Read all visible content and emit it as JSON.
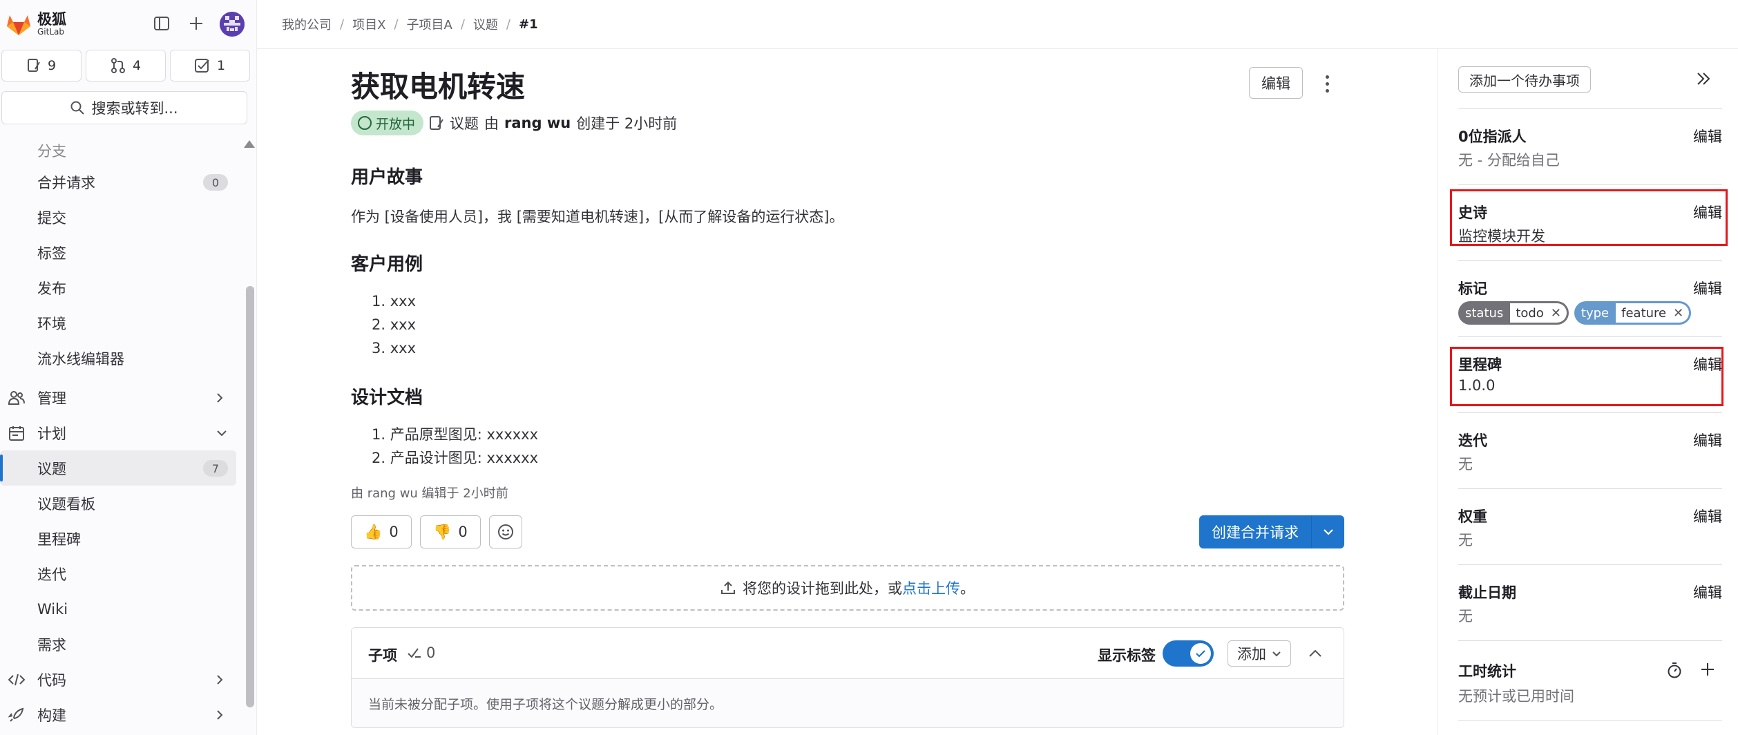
{
  "brand": {
    "name": "极狐",
    "sub": "GitLab"
  },
  "counters": [
    {
      "icon": "issues-icon",
      "value": "9"
    },
    {
      "icon": "merge-request-icon",
      "value": "4"
    },
    {
      "icon": "todo-icon",
      "value": "1"
    }
  ],
  "search": {
    "label": "搜索或转到..."
  },
  "nav": {
    "faded": "分支",
    "code_items": [
      {
        "label": "合并请求",
        "badge": "0"
      },
      {
        "label": "提交"
      },
      {
        "label": "标签"
      },
      {
        "label": "发布"
      },
      {
        "label": "环境"
      },
      {
        "label": "流水线编辑器"
      }
    ],
    "manage": "管理",
    "plan": "计划",
    "plan_items": [
      {
        "label": "议题",
        "badge": "7"
      },
      {
        "label": "议题看板"
      },
      {
        "label": "里程碑"
      },
      {
        "label": "迭代"
      },
      {
        "label": "Wiki"
      },
      {
        "label": "需求"
      }
    ],
    "code": "代码",
    "build": "构建"
  },
  "breadcrumb": [
    "我的公司",
    "项目X",
    "子项目A",
    "议题",
    "#1"
  ],
  "issue": {
    "title": "获取电机转速",
    "edit": "编辑",
    "status": "开放中",
    "type": "议题",
    "by": "由",
    "author": "rang wu",
    "created": "创建于 2小时前"
  },
  "body": {
    "h_story": "用户故事",
    "story": "作为 [设备使用人员]，我 [需要知道电机转速]，[从而了解设备的运行状态]。",
    "h_cases": "客户用例",
    "cases": [
      "1. xxx",
      "2. xxx",
      "3. xxx"
    ],
    "h_design": "设计文档",
    "design": [
      "1. 产品原型图见: xxxxxx",
      "2. 产品设计图见: xxxxxx"
    ],
    "edited": "由 rang wu 编辑于 2小时前"
  },
  "reactions": {
    "up": "0",
    "down": "0"
  },
  "create_mr": "创建合并请求",
  "dropzone": {
    "text": "将您的设计拖到此处，或",
    "link": "点击上传",
    "end": "。"
  },
  "children": {
    "title": "子项",
    "count": "0",
    "show_labels": "显示标签",
    "add": "添加",
    "empty": "当前未被分配子项。使用子项将这个议题分解成更小的部分。"
  },
  "right": {
    "todo": "添加一个待办事项",
    "sections": {
      "assignee": {
        "label": "0位指派人",
        "action": "编辑",
        "value": "无 - 分配给自己"
      },
      "epic": {
        "label": "史诗",
        "action": "编辑",
        "value": "监控模块开发"
      },
      "labels": {
        "label": "标记",
        "action": "编辑"
      },
      "milestone": {
        "label": "里程碑",
        "action": "编辑",
        "value": "1.0.0"
      },
      "iteration": {
        "label": "迭代",
        "action": "编辑",
        "value": "无"
      },
      "weight": {
        "label": "权重",
        "action": "编辑",
        "value": "无"
      },
      "due": {
        "label": "截止日期",
        "action": "编辑",
        "value": "无"
      },
      "time": {
        "label": "工时统计",
        "value": "无预计或已用时间"
      }
    },
    "label_chips": [
      {
        "key": "status",
        "value": "todo",
        "color": "#737278"
      },
      {
        "key": "type",
        "value": "feature",
        "color": "#6699cc"
      }
    ]
  },
  "colors": {
    "accent": "#1f75cb",
    "open": "#24663b",
    "highlight": "#e5171a"
  }
}
